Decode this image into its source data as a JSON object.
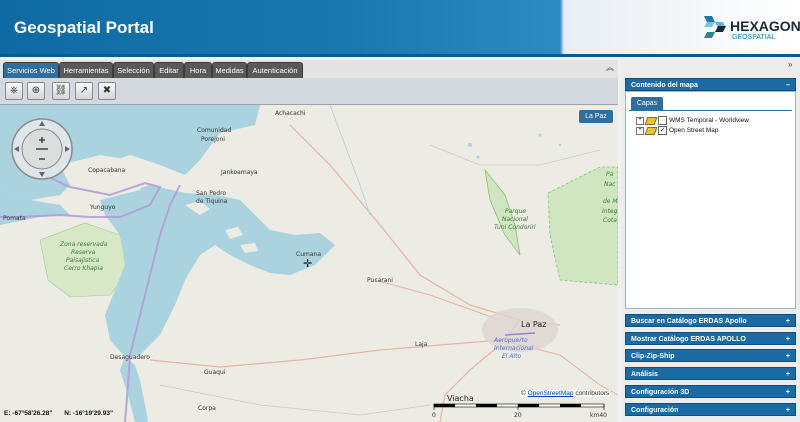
{
  "app": {
    "title": "Geospatial Portal",
    "logo_brand": "HEXAGON",
    "logo_sub": "GEOSPATIAL"
  },
  "tabs": [
    {
      "label": "Servicios Web",
      "active": true
    },
    {
      "label": "Herramientas",
      "active": false
    },
    {
      "label": "Selección",
      "active": false
    },
    {
      "label": "Editar",
      "active": false
    },
    {
      "label": "Hora",
      "active": false
    },
    {
      "label": "Medidas",
      "active": false
    },
    {
      "label": "Autenticación",
      "active": false
    }
  ],
  "toolbar": {
    "icons": [
      "add-wms-icon",
      "add-service-icon",
      "link-service-icon",
      "export-icon",
      "remove-service-icon"
    ]
  },
  "map": {
    "zoom_button": "La Paz",
    "coords": {
      "e": "E: -67°58'26.28\"",
      "n": "N: -16°19'29.93\""
    },
    "attribution_prefix": "©",
    "attribution_link": "OpenStreetMap",
    "attribution_suffix": "contributors",
    "scale": {
      "labels": [
        "0",
        "20",
        "km40"
      ]
    },
    "labels": {
      "achacachi": "Achacachi",
      "comunidad": "Comunidad",
      "porejoni": "Porejoni",
      "copacabana": "Copacabana",
      "jankoamaya": "Jankoamaya",
      "san_pedro": "San Pedro",
      "de_tiquina": "de Tiquina",
      "yunguyo": "Yunguyo",
      "pomata": "Pomata",
      "zona1": "Zona reservada",
      "zona2": "Reserva",
      "zona3": "Paisajistica",
      "zona4": "Cerro Khapia",
      "cumana": "Cumana",
      "parque1": "Parque",
      "parque2": "Nacional",
      "parque3": "Tuni Condoriri",
      "pucarani": "Pucarani",
      "la_paz": "La Paz",
      "laja": "Laja",
      "aero1": "Aeropuerto",
      "aero2": "Internacional",
      "aero3": "El Alto",
      "desaguadero": "Desaguadero",
      "guaqui": "Guaqui",
      "viacha": "Viacha",
      "corpa": "Corpa",
      "edge1": "Pa",
      "edge2": "Nac",
      "edge3": "de M",
      "edge4": "Integ",
      "edge5": "Cota"
    }
  },
  "right_panel": {
    "content_title": "Contenido del mapa",
    "content_toggle": "–",
    "subtab": "Capas",
    "layers": [
      {
        "name": "WMS Temporal - Worldview",
        "checked": false
      },
      {
        "name": "Open Street Map",
        "checked": true
      }
    ],
    "sections": [
      {
        "title": "Buscar en Catálogo ERDAS Apollo",
        "toggle": "+"
      },
      {
        "title": "Mostrar Catálogo ERDAS APOLLO",
        "toggle": "+"
      },
      {
        "title": "Clip-Zip-Ship",
        "toggle": "+"
      },
      {
        "title": "Análisis",
        "toggle": "+"
      },
      {
        "title": "Configuración 3D",
        "toggle": "+"
      },
      {
        "title": "Configuración",
        "toggle": "+"
      }
    ]
  },
  "colors": {
    "header_blue": "#1b79b0",
    "tab_active": "#2f6f9f",
    "tab_inactive": "#595959",
    "panel_title": "#1a6aa3",
    "lake": "#aad3df",
    "border_purple": "#b39ad6"
  }
}
